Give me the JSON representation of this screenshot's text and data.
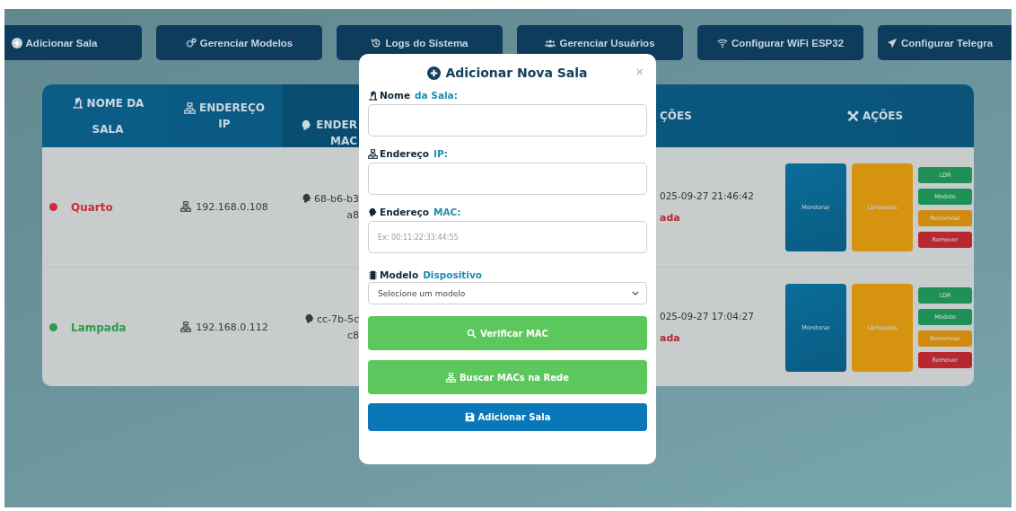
{
  "toolbar": [
    {
      "kind": "plus",
      "label": "Adicionar Sala"
    },
    {
      "kind": "gears",
      "label": "Gerenciar Modelos"
    },
    {
      "kind": "history",
      "label": "Logs do Sistema"
    },
    {
      "kind": "users",
      "label": "Gerenciar Usuários"
    },
    {
      "kind": "wifi",
      "label": "Configurar WiFi ESP32"
    },
    {
      "kind": "send",
      "label": "Configurar Telegra"
    }
  ],
  "table": {
    "columns": [
      {
        "kind": "door",
        "lines": [
          "NOME DA",
          "SALA"
        ]
      },
      {
        "kind": "network",
        "lines": [
          "ENDEREÇO",
          "IP"
        ]
      },
      {
        "kind": "chip",
        "lines": [
          "ENDER",
          "MAC"
        ]
      },
      {
        "kind": "none",
        "lines": [
          "ÇÕES"
        ]
      },
      {
        "kind": "tools",
        "lines": [
          "AÇÕES"
        ]
      }
    ],
    "rows": [
      {
        "name": "Quarto",
        "color": "#c9303c",
        "ip": "192.168.0.108",
        "mac": [
          "68-b6-b3",
          "a8"
        ],
        "time": "025-09-27 21:46:42",
        "status": "ada",
        "actions": {
          "monitor": "Monitorar",
          "lamps": "Lâmpadas",
          "small": [
            "LDR",
            "Modelo",
            "Renomear",
            "Remover"
          ]
        }
      },
      {
        "name": "Lampada",
        "color": "#2e9a4c",
        "ip": "192.168.0.112",
        "mac": [
          "cc-7b-5c",
          "c8"
        ],
        "time": "025-09-27 17:04:27",
        "status": "ada",
        "actions": {
          "monitor": "Monitorar",
          "lamps": "Lâmpadas",
          "small": [
            "LDR",
            "Modelo",
            "Renomear",
            "Remover"
          ]
        }
      }
    ]
  },
  "modal": {
    "title": "Adicionar Nova Sala",
    "close": "×",
    "fields": [
      {
        "kind": "door",
        "label": "Nome",
        "accent": "da Sala:"
      },
      {
        "kind": "network",
        "label": "Endereço",
        "accent": "IP:"
      },
      {
        "kind": "chip",
        "label": "Endereço",
        "accent": "MAC:",
        "placeholder": "Ex: 00:11:22:33:44:55"
      },
      {
        "kind": "memory",
        "label": "Modelo",
        "accent": "Dispositivo",
        "value": "Selecione um modelo"
      }
    ],
    "buttons": [
      {
        "kind": "search",
        "label": "Verificar MAC"
      },
      {
        "kind": "network",
        "label": "Buscar MACs na Rede"
      },
      {
        "kind": "save",
        "label": "Adicionar Sala"
      }
    ]
  }
}
